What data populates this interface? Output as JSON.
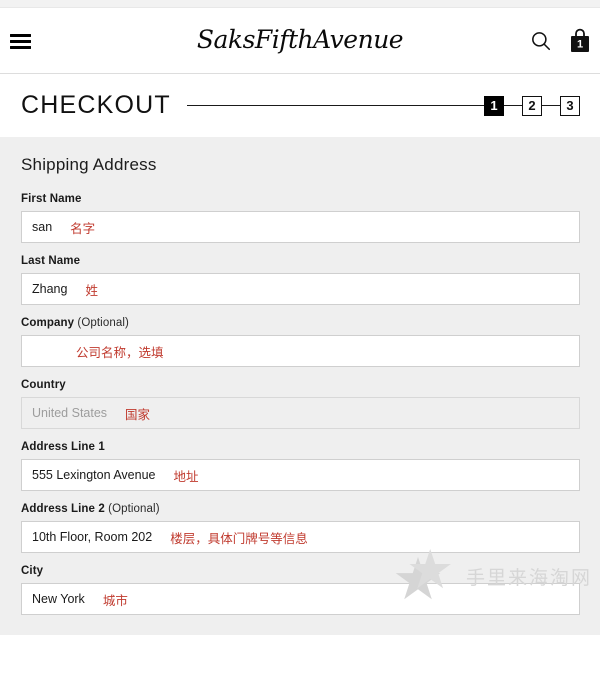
{
  "header": {
    "menu_icon": "hamburger-menu-icon",
    "logo_text": "SaksFifthAvenue",
    "search_icon": "search-icon",
    "bag_icon": "shopping-bag-icon",
    "bag_count": "1"
  },
  "checkout": {
    "title": "CHECKOUT",
    "steps": [
      {
        "label": "1",
        "active": true
      },
      {
        "label": "2",
        "active": false
      },
      {
        "label": "3",
        "active": false
      }
    ]
  },
  "shipping": {
    "section_title": "Shipping Address",
    "fields": [
      {
        "name": "first-name",
        "label": "First Name",
        "optional_text": "",
        "value": "san",
        "annotation": "名字",
        "disabled": false,
        "indent": false
      },
      {
        "name": "last-name",
        "label": "Last Name",
        "optional_text": "",
        "value": "Zhang",
        "annotation": "姓",
        "disabled": false,
        "indent": false
      },
      {
        "name": "company",
        "label": "Company",
        "optional_text": "(Optional)",
        "value": "",
        "annotation": "公司名称，选填",
        "disabled": false,
        "indent": true
      },
      {
        "name": "country",
        "label": "Country",
        "optional_text": "",
        "value": "United States",
        "annotation": "国家",
        "disabled": true,
        "indent": false
      },
      {
        "name": "address-line-1",
        "label": "Address Line 1",
        "optional_text": "",
        "value": "555 Lexington Avenue",
        "annotation": "地址",
        "disabled": false,
        "indent": false
      },
      {
        "name": "address-line-2",
        "label": "Address Line 2",
        "optional_text": "(Optional)",
        "value": "10th Floor, Room 202",
        "annotation": "楼层，具体门牌号等信息",
        "disabled": false,
        "indent": false
      },
      {
        "name": "city",
        "label": "City",
        "optional_text": "",
        "value": "New York",
        "annotation": "城市",
        "disabled": false,
        "indent": false
      }
    ]
  },
  "watermark": {
    "text": "手里来海淘网",
    "star_glyph": "★"
  },
  "colors": {
    "annotation_red": "#c03a2e",
    "form_background": "#efefef",
    "accent_black": "#000000",
    "watermark_gray": "#d6d6d6"
  }
}
